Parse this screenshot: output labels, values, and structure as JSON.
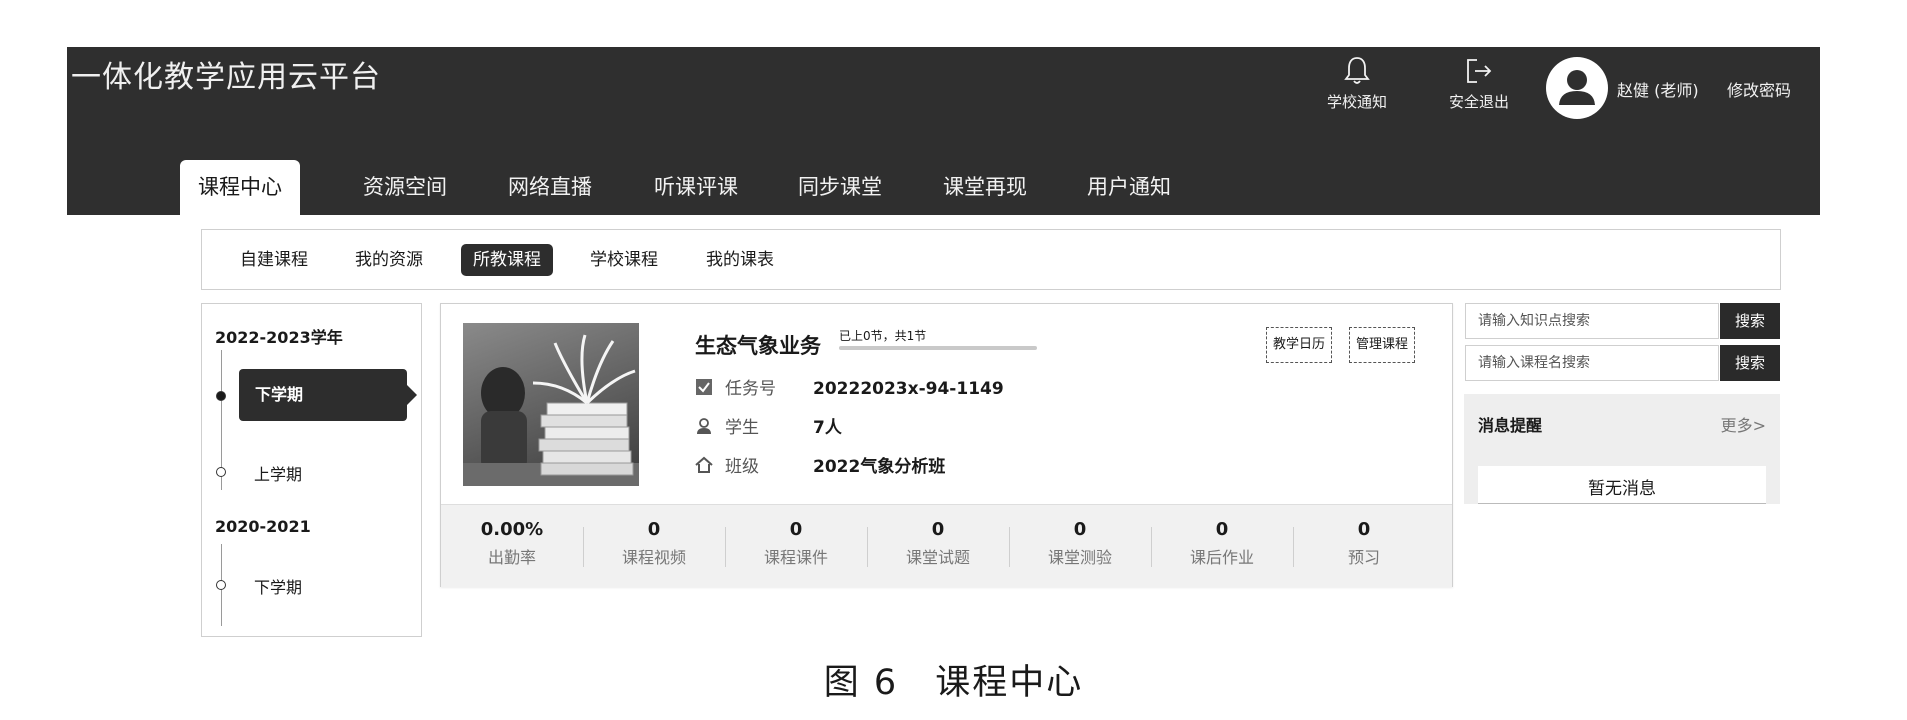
{
  "header": {
    "app_title": "一体化教学应用云平台",
    "actions": [
      {
        "label": "学校通知",
        "icon": "bell-icon"
      },
      {
        "label": "安全退出",
        "icon": "logout-icon"
      }
    ],
    "user_name": "赵健 (老师)",
    "change_password": "修改密码"
  },
  "main_tabs": [
    "课程中心",
    "资源空间",
    "网络直播",
    "听课评课",
    "同步课堂",
    "课堂再现",
    "用户通知"
  ],
  "main_tabs_active": "课程中心",
  "sub_nav": [
    "自建课程",
    "我的资源",
    "所教课程",
    "学校课程",
    "我的课表"
  ],
  "sub_nav_active": "所教课程",
  "terms": {
    "years": [
      {
        "label": "2022-2023学年",
        "items": [
          {
            "label": "下学期",
            "active": true
          },
          {
            "label": "上学期",
            "active": false
          }
        ]
      },
      {
        "label": "2020-2021",
        "items": [
          {
            "label": "下学期",
            "active": false
          }
        ]
      }
    ]
  },
  "course": {
    "title": "生态气象业务",
    "progress_text": "已上0节，共1节",
    "progress": 0,
    "buttons": [
      "教学日历",
      "管理课程"
    ],
    "task_label": "任务号",
    "task_value": "20222023x-94-1149",
    "students_label": "学生",
    "students_value": "7人",
    "class_label": "班级",
    "class_value": "2022气象分析班",
    "stats": [
      {
        "value": "0.00%",
        "label": "出勤率"
      },
      {
        "value": "0",
        "label": "课程视频"
      },
      {
        "value": "0",
        "label": "课程课件"
      },
      {
        "value": "0",
        "label": "课堂试题"
      },
      {
        "value": "0",
        "label": "课堂测验"
      },
      {
        "value": "0",
        "label": "课后作业"
      },
      {
        "value": "0",
        "label": "预习"
      }
    ]
  },
  "search": {
    "knowledge_placeholder": "请输入知识点搜索",
    "course_placeholder": "请输入课程名搜索",
    "button_label": "搜索"
  },
  "messages": {
    "title": "消息提醒",
    "more": "更多>",
    "empty": "暂无消息"
  },
  "caption": "图 6　课程中心",
  "colors": {
    "header_bg": "#2f2f2f",
    "active_dark": "#2d2d2d"
  }
}
